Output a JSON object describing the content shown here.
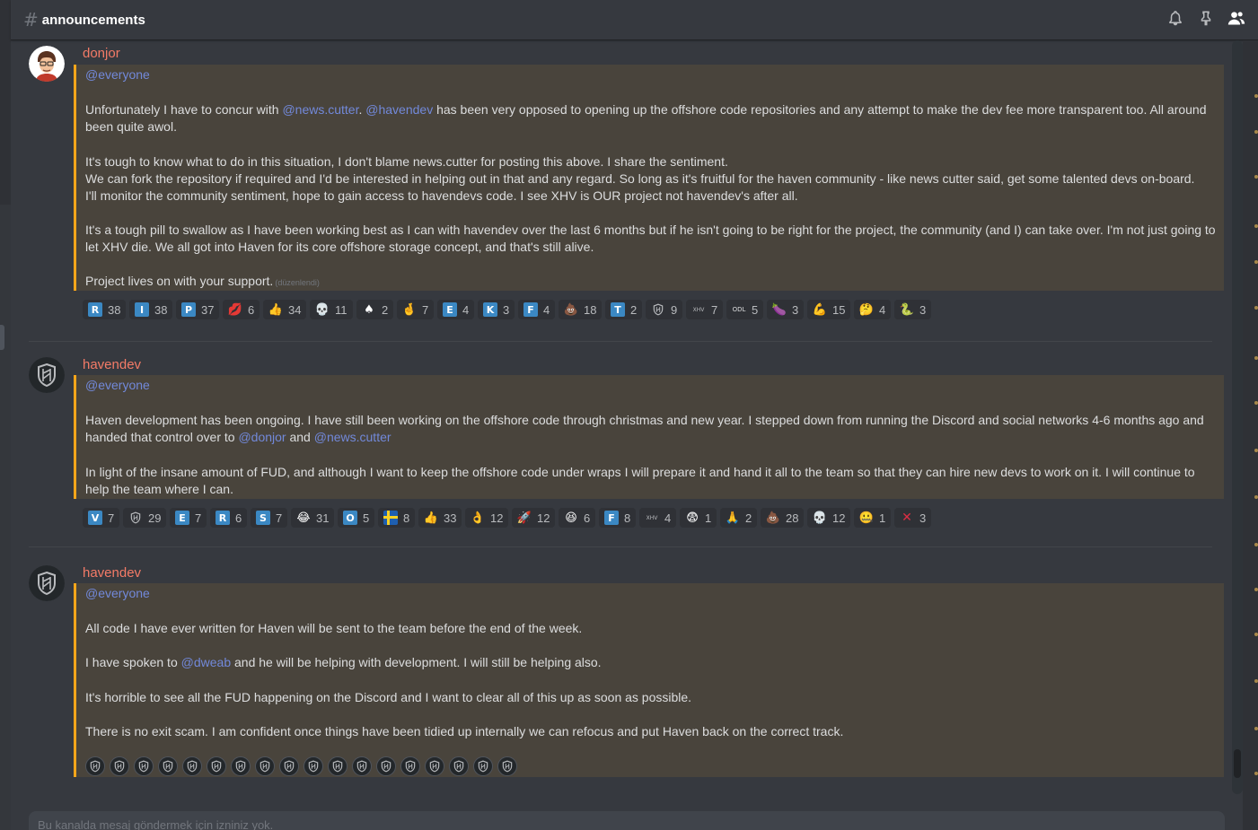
{
  "header": {
    "hash": "#",
    "channel": "announcements"
  },
  "input_placeholder": "Bu kanalda mesaj göndermek için izniniz yok.",
  "messages": [
    {
      "author": "donjor",
      "mention_all": "@everyone",
      "p1a": "Unfortunately I have to concur with ",
      "m1": "@news.cutter",
      "p1b": ". ",
      "m2": "@havendev",
      "p1c": " has been very opposed to opening up the offshore code repositories and any attempt to make the dev fee more transparent too. All around",
      "p1d": "been quite awol.",
      "p2": "It's tough to know what to do in this situation, I don't blame news.cutter for posting this above. I share the sentiment.",
      "p3": "We can fork the repository if required and I'd be interested in helping out in that and any regard. So long as it's fruitful for the haven community - like news cutter said, get some talented devs on-board.",
      "p4": "I'll monitor the community sentiment, hope to gain access to havendevs code. I see XHV is OUR project not havendev's after all.",
      "p5": "It's a tough pill to swallow as I have been working best as I can with havendev over the last 6 months but if he isn't going to be right for the project, the community (and I) can take over. I'm not just going to",
      "p6": "let XHV die. We all got into Haven for its core offshore storage concept, and that's still alive.",
      "p7": "Project lives on with your support.",
      "edited": "(düzenlendi)",
      "reactions": [
        {
          "icon": "R",
          "bg": "#3b88c3",
          "count": "38"
        },
        {
          "icon": "I",
          "bg": "#3b88c3",
          "count": "38"
        },
        {
          "icon": "P",
          "bg": "#3b88c3",
          "count": "37"
        },
        {
          "icon": "💋",
          "bg": "",
          "count": "6"
        },
        {
          "icon": "👍",
          "bg": "",
          "count": "34"
        },
        {
          "icon": "💀",
          "bg": "",
          "count": "11"
        },
        {
          "icon": "♠",
          "bg": "",
          "count": "2"
        },
        {
          "icon": "🤞",
          "bg": "",
          "count": "7"
        },
        {
          "icon": "E",
          "bg": "#3b88c3",
          "count": "4"
        },
        {
          "icon": "K",
          "bg": "#3b88c3",
          "count": "3"
        },
        {
          "icon": "F",
          "bg": "#3b88c3",
          "count": "4"
        },
        {
          "icon": "💩",
          "bg": "",
          "count": "18"
        },
        {
          "icon": "T",
          "bg": "#3b88c3",
          "count": "2"
        },
        {
          "icon": "shield",
          "bg": "",
          "count": "9"
        },
        {
          "icon": "xhv",
          "bg": "",
          "count": "7"
        },
        {
          "icon": "odl",
          "bg": "",
          "count": "5"
        },
        {
          "icon": "🍆",
          "bg": "",
          "count": "3"
        },
        {
          "icon": "💪",
          "bg": "",
          "count": "15"
        },
        {
          "icon": "🤔",
          "bg": "",
          "count": "4"
        },
        {
          "icon": "🐍",
          "bg": "",
          "count": "3"
        }
      ]
    },
    {
      "author": "havendev",
      "mention_all": "@everyone",
      "p1": "Haven development has been ongoing. I have still been working on the offshore code through christmas and new year. I stepped down from running the Discord and social networks 4-6 months ago and",
      "p2a": "handed that control over to ",
      "m1": "@donjor",
      "p2b": " and ",
      "m2": "@news.cutter",
      "p3": "In light of the insane amount of FUD, and although I want to keep the offshore code under wraps I will prepare it and hand it all to the team so that they can hire new devs to work on it. I will continue to",
      "p4": "help the team where I can.",
      "reactions": [
        {
          "icon": "V",
          "bg": "#3b88c3",
          "count": "7"
        },
        {
          "icon": "shield",
          "bg": "",
          "count": "29"
        },
        {
          "icon": "E",
          "bg": "#3b88c3",
          "count": "7"
        },
        {
          "icon": "R",
          "bg": "#3b88c3",
          "count": "6"
        },
        {
          "icon": "S",
          "bg": "#3b88c3",
          "count": "7"
        },
        {
          "icon": "😂",
          "bg": "",
          "count": "31"
        },
        {
          "icon": "O",
          "bg": "#3b88c3",
          "count": "5"
        },
        {
          "icon": "se-flag",
          "bg": "",
          "count": "8"
        },
        {
          "icon": "👍",
          "bg": "",
          "count": "33"
        },
        {
          "icon": "👌",
          "bg": "",
          "count": "12"
        },
        {
          "icon": "🚀",
          "bg": "",
          "count": "12"
        },
        {
          "icon": "😆",
          "bg": "",
          "count": "6"
        },
        {
          "icon": "F",
          "bg": "#3b88c3",
          "count": "8"
        },
        {
          "icon": "xhv",
          "bg": "",
          "count": "4"
        },
        {
          "icon": "😨",
          "bg": "",
          "count": "1"
        },
        {
          "icon": "🙏",
          "bg": "",
          "count": "2"
        },
        {
          "icon": "💩",
          "bg": "",
          "count": "28"
        },
        {
          "icon": "💀",
          "bg": "",
          "count": "12"
        },
        {
          "icon": "🤐",
          "bg": "",
          "count": "1"
        },
        {
          "icon": "✕",
          "bg": "",
          "count": "3"
        }
      ]
    },
    {
      "author": "havendev",
      "mention_all": "@everyone",
      "p1": "All code I have ever written for Haven will be sent to the team before the end of the week.",
      "p2a": "I have spoken to ",
      "m1": "@dweab",
      "p2b": " and he will be helping with development. I will still be helping also.",
      "p3": "It's horrible to see all the FUD happening on the Discord and I want to clear all of this up as soon as possible.",
      "p4": "There is no exit scam. I am confident once things have been tidied up internally we can refocus and put Haven back on the correct track.",
      "shield_count": 18
    }
  ]
}
